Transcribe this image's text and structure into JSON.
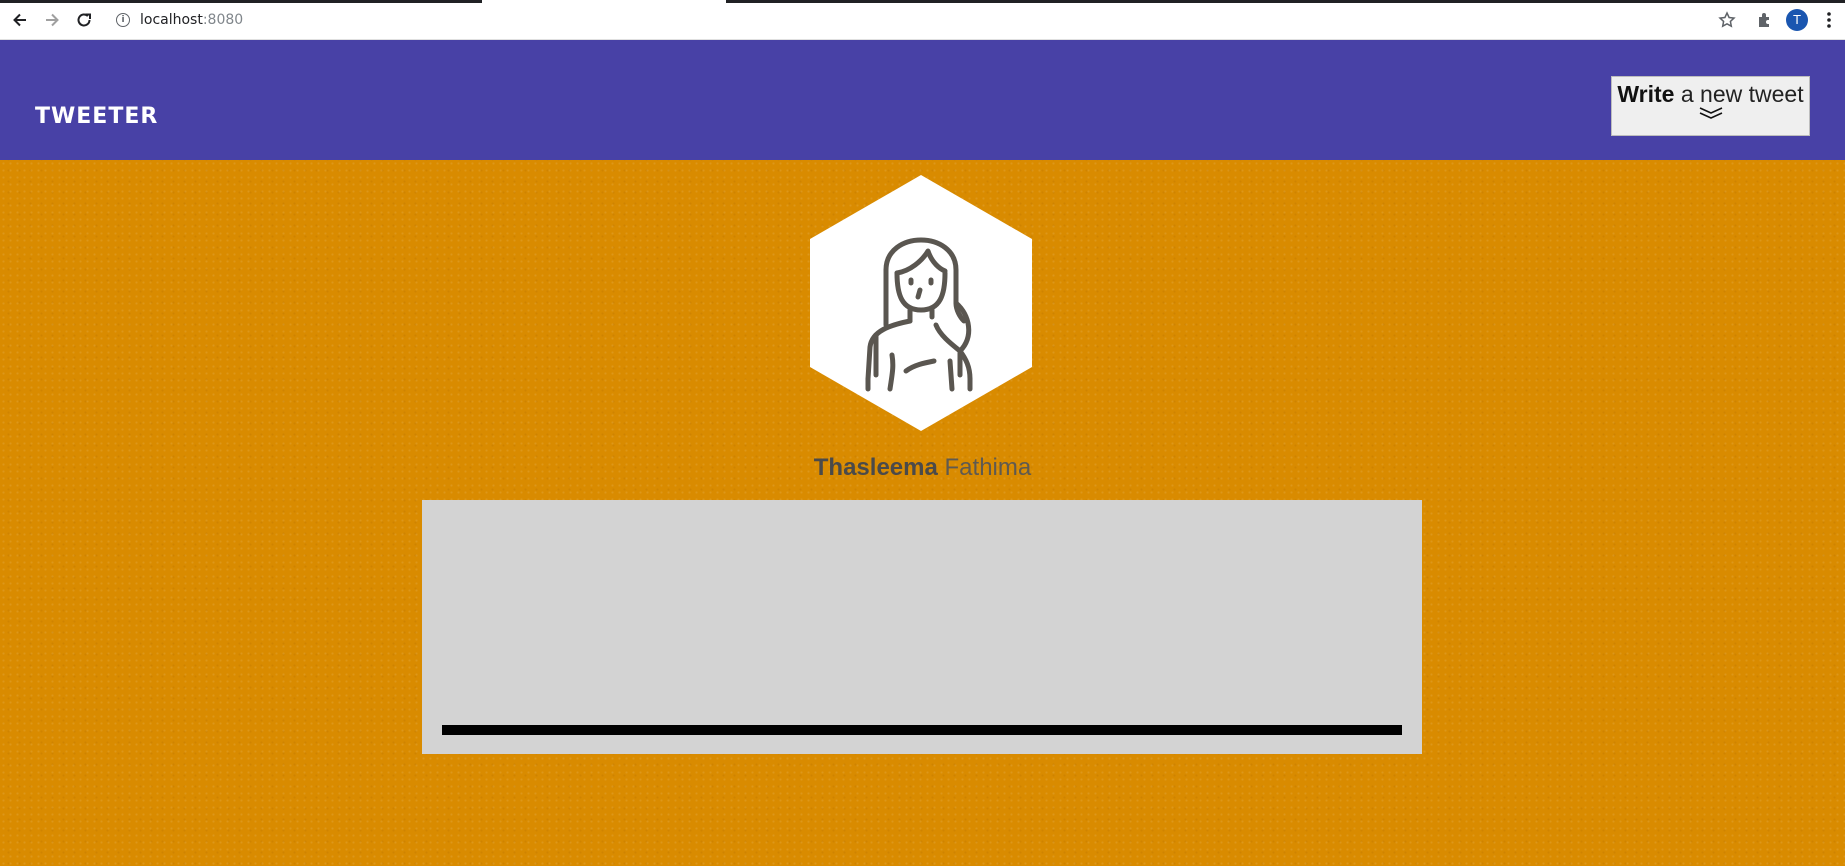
{
  "browser": {
    "url_host": "localhost",
    "url_port": ":8080",
    "profile_initial": "T"
  },
  "header": {
    "logo": "TWEETER",
    "write_button": {
      "bold": "Write",
      "rest": " a new tweet"
    }
  },
  "profile": {
    "first_name": "Thasleema",
    "last_name": "Fathima"
  },
  "colors": {
    "header_bg": "#4841a6",
    "page_bg": "#d98b00",
    "tweet_box_bg": "#d3d3d3"
  }
}
